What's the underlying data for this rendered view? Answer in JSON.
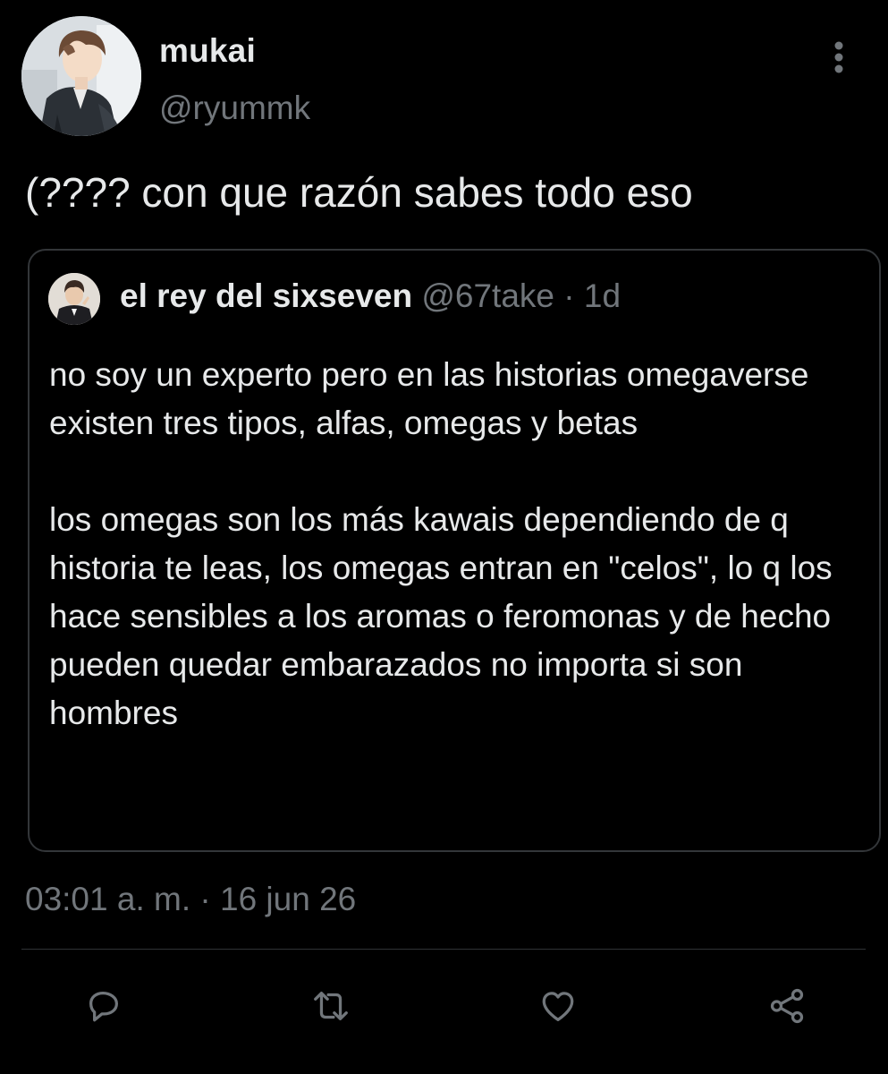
{
  "author": {
    "name": "mukai",
    "handle": "@ryummk"
  },
  "tweet": {
    "text": "(???? con que razón sabes todo eso",
    "timestamp": "03:01 a. m.",
    "separator": "·",
    "date": "16 jun 26"
  },
  "quote": {
    "name": "el rey del sixseven",
    "handle": "@67take",
    "separator": "·",
    "time": "1d",
    "paragraphs": [
      "no soy un experto pero en las historias omegaverse existen tres tipos, alfas, omegas y betas",
      "los omegas son los más kawais dependiendo de q historia te leas, los omegas entran en \"celos\", lo q los hace sensibles a los aromas o feromonas y de hecho pueden quedar embarazados no importa si son hombres"
    ]
  },
  "actions": {
    "reply_icon": "reply-icon",
    "retweet_icon": "retweet-icon",
    "like_icon": "like-icon",
    "share_icon": "share-icon"
  },
  "colors": {
    "background": "#000000",
    "primary_text": "#e7e9ea",
    "secondary_text": "#71767b",
    "border": "#333639"
  }
}
